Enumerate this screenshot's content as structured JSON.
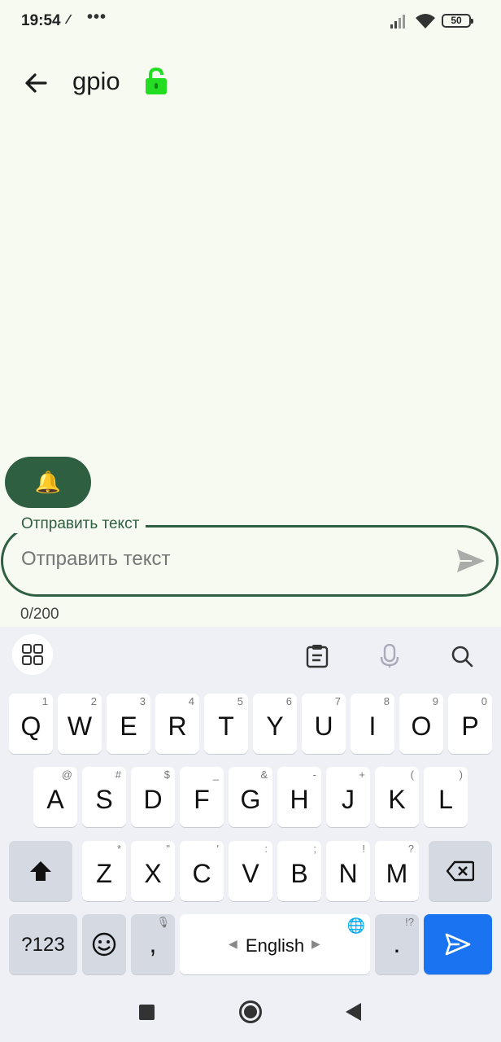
{
  "status_bar": {
    "time": "19:54",
    "battery": "50",
    "icons": [
      "signal-icon",
      "wifi-icon",
      "battery-icon"
    ]
  },
  "app_bar": {
    "title": "gpio",
    "lock_color": "#22dd22"
  },
  "bell_button": {
    "icon": "🔔",
    "color": "#2f5f41"
  },
  "message_field": {
    "label": "Отправить текст",
    "placeholder": "Отправить текст",
    "value": "",
    "counter": "0/200"
  },
  "keyboard": {
    "row1": [
      {
        "k": "Q",
        "s": "1"
      },
      {
        "k": "W",
        "s": "2"
      },
      {
        "k": "E",
        "s": "3"
      },
      {
        "k": "R",
        "s": "4"
      },
      {
        "k": "T",
        "s": "5"
      },
      {
        "k": "Y",
        "s": "6"
      },
      {
        "k": "U",
        "s": "7"
      },
      {
        "k": "I",
        "s": "8"
      },
      {
        "k": "O",
        "s": "9"
      },
      {
        "k": "P",
        "s": "0"
      }
    ],
    "row2": [
      {
        "k": "A",
        "s": "@"
      },
      {
        "k": "S",
        "s": "#"
      },
      {
        "k": "D",
        "s": "$"
      },
      {
        "k": "F",
        "s": "_"
      },
      {
        "k": "G",
        "s": "&"
      },
      {
        "k": "H",
        "s": "-"
      },
      {
        "k": "J",
        "s": "+"
      },
      {
        "k": "K",
        "s": "("
      },
      {
        "k": "L",
        "s": ")"
      }
    ],
    "row3": [
      {
        "k": "Z",
        "s": "*"
      },
      {
        "k": "X",
        "s": "\""
      },
      {
        "k": "C",
        "s": "'"
      },
      {
        "k": "V",
        "s": ":"
      },
      {
        "k": "B",
        "s": ";"
      },
      {
        "k": "N",
        "s": "!"
      },
      {
        "k": "M",
        "s": "?"
      }
    ],
    "symbols_label": "?123",
    "comma_label": ",",
    "space_label": "English",
    "period_label": ".",
    "period_sub": "!?",
    "accent_color": "#1a73f0"
  }
}
